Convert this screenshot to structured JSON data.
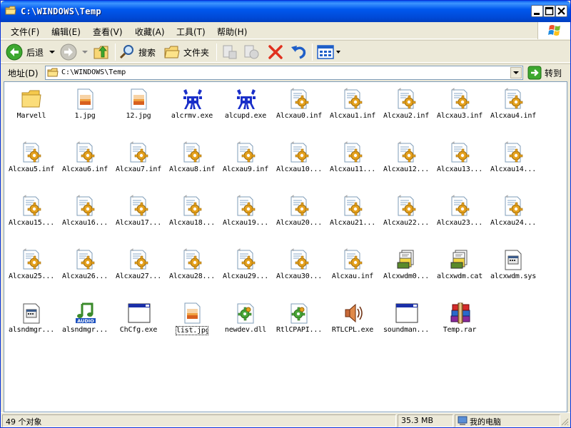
{
  "title": "C:\\WINDOWS\\Temp",
  "menu": [
    {
      "label": "文件(F)"
    },
    {
      "label": "编辑(E)"
    },
    {
      "label": "查看(V)"
    },
    {
      "label": "收藏(A)"
    },
    {
      "label": "工具(T)"
    },
    {
      "label": "帮助(H)"
    }
  ],
  "toolbar": {
    "back_label": "后退",
    "search_label": "搜索",
    "folders_label": "文件夹"
  },
  "address": {
    "label": "地址(D)",
    "value": "C:\\WINDOWS\\Temp",
    "go_label": "转到"
  },
  "files": [
    {
      "name": "Marvell",
      "icon": "folder-icon"
    },
    {
      "name": "1.jpg",
      "icon": "image-icon"
    },
    {
      "name": "12.jpg",
      "icon": "image-icon"
    },
    {
      "name": "alcrmv.exe",
      "icon": "realtek-crab-icon"
    },
    {
      "name": "alcupd.exe",
      "icon": "realtek-crab-icon"
    },
    {
      "name": "Alcxau0.inf",
      "icon": "inf-gear-icon"
    },
    {
      "name": "Alcxau1.inf",
      "icon": "inf-gear-icon"
    },
    {
      "name": "Alcxau2.inf",
      "icon": "inf-gear-icon"
    },
    {
      "name": "Alcxau3.inf",
      "icon": "inf-gear-icon"
    },
    {
      "name": "Alcxau4.inf",
      "icon": "inf-gear-icon"
    },
    {
      "name": "Alcxau5.inf",
      "icon": "inf-gear-icon"
    },
    {
      "name": "Alcxau6.inf",
      "icon": "inf-gear-icon"
    },
    {
      "name": "Alcxau7.inf",
      "icon": "inf-gear-icon"
    },
    {
      "name": "Alcxau8.inf",
      "icon": "inf-gear-icon"
    },
    {
      "name": "Alcxau9.inf",
      "icon": "inf-gear-icon"
    },
    {
      "name": "Alcxau10...",
      "icon": "inf-gear-icon"
    },
    {
      "name": "Alcxau11...",
      "icon": "inf-gear-icon"
    },
    {
      "name": "Alcxau12...",
      "icon": "inf-gear-icon"
    },
    {
      "name": "Alcxau13...",
      "icon": "inf-gear-icon"
    },
    {
      "name": "Alcxau14...",
      "icon": "inf-gear-icon"
    },
    {
      "name": "Alcxau15...",
      "icon": "inf-gear-icon"
    },
    {
      "name": "Alcxau16...",
      "icon": "inf-gear-icon"
    },
    {
      "name": "Alcxau17...",
      "icon": "inf-gear-icon"
    },
    {
      "name": "Alcxau18...",
      "icon": "inf-gear-icon"
    },
    {
      "name": "Alcxau19...",
      "icon": "inf-gear-icon"
    },
    {
      "name": "Alcxau20...",
      "icon": "inf-gear-icon"
    },
    {
      "name": "Alcxau21...",
      "icon": "inf-gear-icon"
    },
    {
      "name": "Alcxau22...",
      "icon": "inf-gear-icon"
    },
    {
      "name": "Alcxau23...",
      "icon": "inf-gear-icon"
    },
    {
      "name": "Alcxau24...",
      "icon": "inf-gear-icon"
    },
    {
      "name": "Alcxau25...",
      "icon": "inf-gear-icon"
    },
    {
      "name": "Alcxau26...",
      "icon": "inf-gear-icon"
    },
    {
      "name": "Alcxau27...",
      "icon": "inf-gear-icon"
    },
    {
      "name": "Alcxau28...",
      "icon": "inf-gear-icon"
    },
    {
      "name": "Alcxau29...",
      "icon": "inf-gear-icon"
    },
    {
      "name": "Alcxau30...",
      "icon": "inf-gear-icon"
    },
    {
      "name": "Alcxau.inf",
      "icon": "inf-gear-icon"
    },
    {
      "name": "Alcxwdm0...",
      "icon": "catalog-icon"
    },
    {
      "name": "alcxwdm.cat",
      "icon": "catalog-icon"
    },
    {
      "name": "alcxwdm.sys",
      "icon": "system-file-icon"
    },
    {
      "name": "alsndmgr...",
      "icon": "system-file-icon"
    },
    {
      "name": "alsndmgr...",
      "icon": "audio-note-icon"
    },
    {
      "name": "ChCfg.exe",
      "icon": "exe-window-icon"
    },
    {
      "name": "list.jpg",
      "icon": "image-icon",
      "focused": true
    },
    {
      "name": "newdev.dll",
      "icon": "dll-gear-icon"
    },
    {
      "name": "RtlCPAPI...",
      "icon": "dll-gear-icon"
    },
    {
      "name": "RTLCPL.exe",
      "icon": "speaker-icon"
    },
    {
      "name": "soundman...",
      "icon": "exe-window-icon"
    },
    {
      "name": "Temp.rar",
      "icon": "winrar-books-icon"
    }
  ],
  "status": {
    "count": "49 个对象",
    "size": "35.3 MB",
    "location": "我的电脑"
  }
}
